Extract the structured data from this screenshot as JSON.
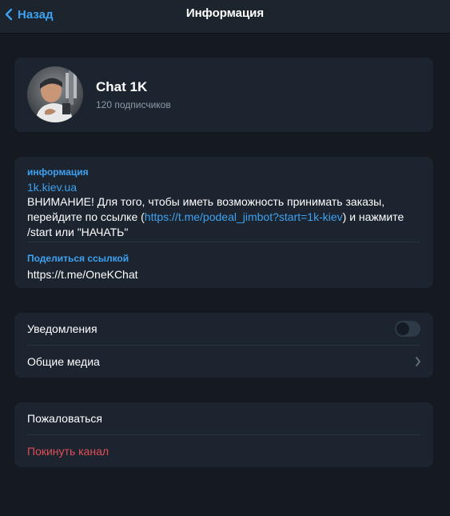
{
  "header": {
    "back_label": "Назад",
    "title": "Информация"
  },
  "profile": {
    "name": "Chat 1K",
    "subscribers": "120 подписчиков"
  },
  "info": {
    "section_label": "информация",
    "site_link": "1k.kiev.ua",
    "desc_part1": "ВНИМАНИЕ! Для того, чтобы иметь возможность принимать заказы, перейдите по ссылке (",
    "desc_link": "https://t.me/podeal_jimbot?start=1k-kiev",
    "desc_part2": ") и нажмите /start или \"НАЧАТЬ\"",
    "share_label": "Поделиться ссылкой",
    "share_url": "https://t.me/OneKChat"
  },
  "settings": {
    "notifications_label": "Уведомления",
    "notifications_enabled": false,
    "shared_media_label": "Общие медиа"
  },
  "actions": {
    "report_label": "Пожаловаться",
    "leave_label": "Покинуть канал"
  },
  "colors": {
    "accent": "#3ea2f0",
    "danger": "#e14e57",
    "background": "#151a20",
    "card": "#1c242f"
  }
}
